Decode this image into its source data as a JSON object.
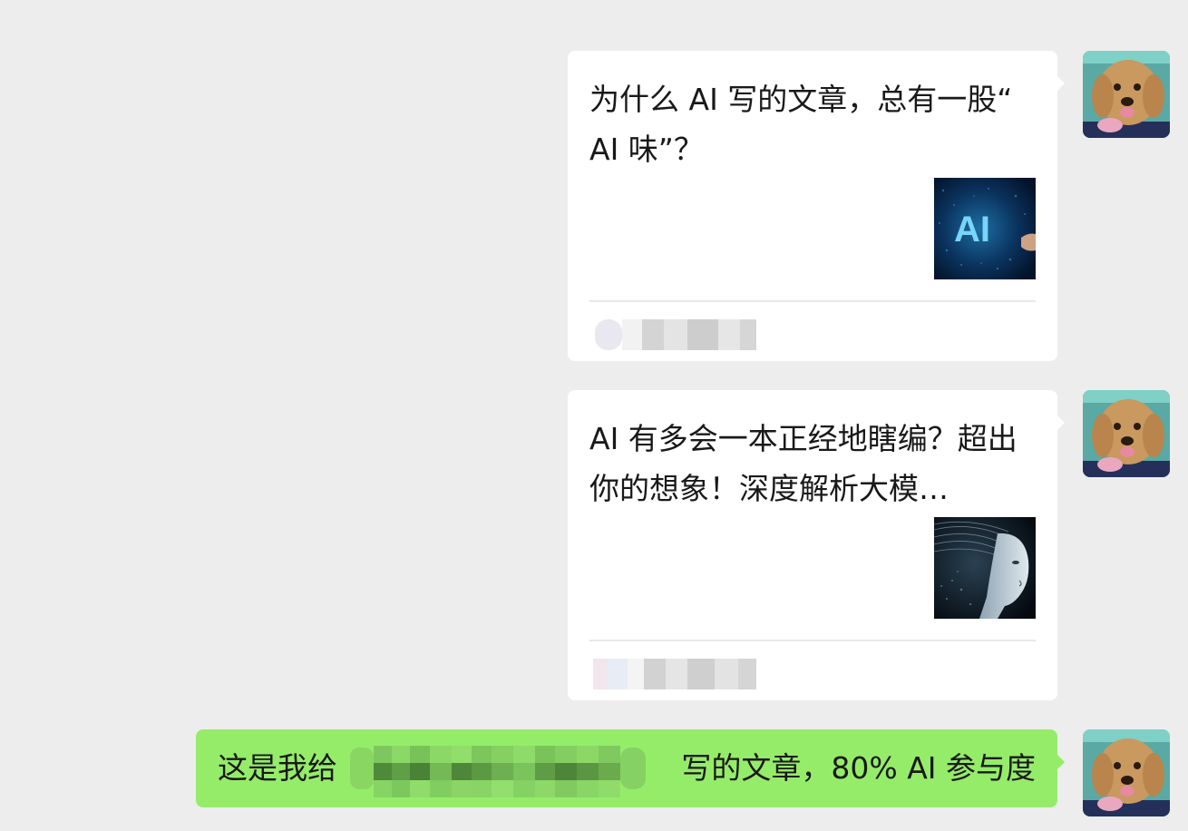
{
  "messages": [
    {
      "type": "link-card",
      "title": "为什么 AI 写的文章，总有一股“ AI 味”？",
      "thumbnail": "ai-glowing-letters-image",
      "source_blurred": true
    },
    {
      "type": "link-card",
      "title": "AI 有多会一本正经地瞎编？超出你的想象！深度解析大模…",
      "thumbnail": "ai-robot-head-image",
      "source_blurred": true
    },
    {
      "type": "text",
      "text_prefix": "这是我给",
      "text_suffix": "写的文章，80% AI 参与度",
      "redacted": true
    }
  ],
  "avatar": "dog-avatar-image",
  "colors": {
    "background": "#ededed",
    "card": "#ffffff",
    "own_bubble": "#95ec69",
    "text": "#191919"
  }
}
